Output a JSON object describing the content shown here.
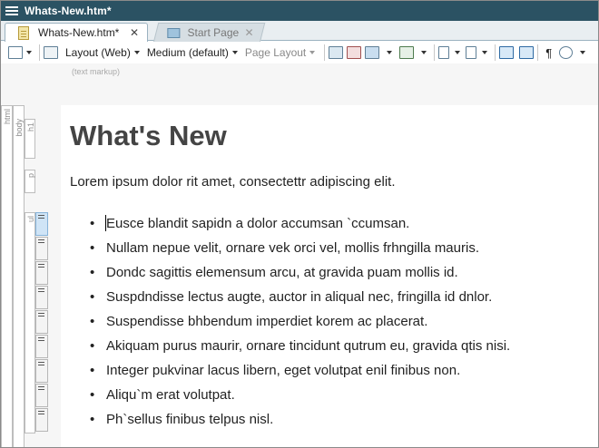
{
  "window": {
    "title": "Whats-New.htm*"
  },
  "tabs": [
    {
      "label": "Whats-New.htm*",
      "active": true
    },
    {
      "label": "Start Page",
      "active": false
    }
  ],
  "toolbar": {
    "layout_view": "Layout (Web)",
    "medium": "Medium (default)",
    "page_layout": "Page Layout",
    "icons": [
      "view-icon",
      "pointer-icon",
      "insert-table-icon",
      "image-icon",
      "picture-icon",
      "delete-image-icon",
      "text-box-icon",
      "font-icon",
      "info-icon",
      "code-icon",
      "pilcrow-icon",
      "eye-icon"
    ]
  },
  "subbar": {
    "hint": "(text markup)"
  },
  "structure": {
    "tags": [
      "html",
      "body",
      "h1",
      "p",
      "ul"
    ]
  },
  "document": {
    "heading": "What's New",
    "lead": "Lorem ipsum dolor rit amet, consectettr adipiscing elit.",
    "items": [
      "Eusce blandit sapidn a dolor accumsan `ccumsan.",
      "Nullam nepue velit, ornare vek orci vel, mollis frhngilla mauris.",
      "Dondc sagittis elemensum arcu, at gravida puam mollis id.",
      "Suspdndisse lectus augte, auctor in aliqual nec, fringilla id dnlor.",
      "Suspendisse bhbendum imperdiet korem ac placerat.",
      "Akiquam purus maurir, ornare tincidunt qutrum eu, gravida qtis nisi.",
      "Integer pukvinar lacus libern, eget volutpat enil finibus non.",
      "Aliqu`m erat volutpat.",
      "Ph`sellus finibus telpus nisl."
    ]
  },
  "colors": {
    "titlebar": "#2b5263",
    "heading": "#444444",
    "selection": "#cfe4f6"
  }
}
